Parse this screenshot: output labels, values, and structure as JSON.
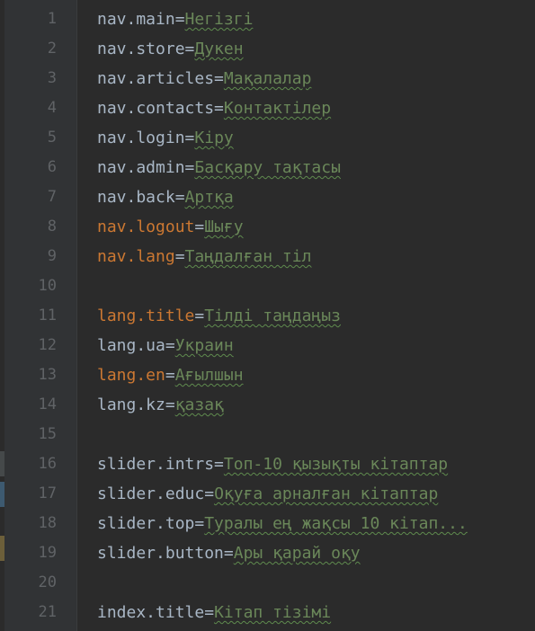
{
  "editor": {
    "colors": {
      "background": "#2b2b2b",
      "gutter": "#313335",
      "line_number": "#606366",
      "key": "#a9b7c6",
      "key_highlighted": "#cc7832",
      "value": "#6a8759"
    },
    "lines": [
      {
        "number": "1",
        "key": "nav.main",
        "eq": "=",
        "value": "Негізгі"
      },
      {
        "number": "2",
        "key": "nav.store",
        "eq": "=",
        "value": "Дукен"
      },
      {
        "number": "3",
        "key": "nav.articles",
        "eq": "=",
        "value": "Мақалалар"
      },
      {
        "number": "4",
        "key": "nav.contacts",
        "eq": "=",
        "value": "Контактілер"
      },
      {
        "number": "5",
        "key": "nav.login",
        "eq": "=",
        "value": "Кіру"
      },
      {
        "number": "6",
        "key": "nav.admin",
        "eq": "=",
        "value": "Басқару тақтасы"
      },
      {
        "number": "7",
        "key": "nav.back",
        "eq": "=",
        "value": "Артқа"
      },
      {
        "number": "8",
        "key": "nav.logout",
        "eq": "=",
        "value": "Шығу"
      },
      {
        "number": "9",
        "key": "nav.lang",
        "eq": "=",
        "value": "Таңдалған тіл"
      },
      {
        "number": "10",
        "key": "",
        "eq": "",
        "value": ""
      },
      {
        "number": "11",
        "key": "lang.title",
        "eq": "=",
        "value": "Тілді таңдаңыз"
      },
      {
        "number": "12",
        "key": "lang.ua",
        "eq": "=",
        "value": "Украин"
      },
      {
        "number": "13",
        "key": "lang.en",
        "eq": "=",
        "value": "Ағылшын"
      },
      {
        "number": "14",
        "key": "lang.kz",
        "eq": "=",
        "value": "қазақ"
      },
      {
        "number": "15",
        "key": "",
        "eq": "",
        "value": ""
      },
      {
        "number": "16",
        "key": "slider.intrs",
        "eq": "=",
        "value": "Топ-10 қызықты кітаптар"
      },
      {
        "number": "17",
        "key": "slider.educ",
        "eq": "=",
        "value": "Оқуға арналған кітаптар"
      },
      {
        "number": "18",
        "key": "slider.top",
        "eq": "=",
        "value": "Туралы ең жақсы 10 кітап..."
      },
      {
        "number": "19",
        "key": "slider.button",
        "eq": "=",
        "value": "Ары қарай оқу"
      },
      {
        "number": "20",
        "key": "",
        "eq": "",
        "value": ""
      },
      {
        "number": "21",
        "key": "index.title",
        "eq": "=",
        "value": "Кітап тізімі"
      }
    ]
  }
}
